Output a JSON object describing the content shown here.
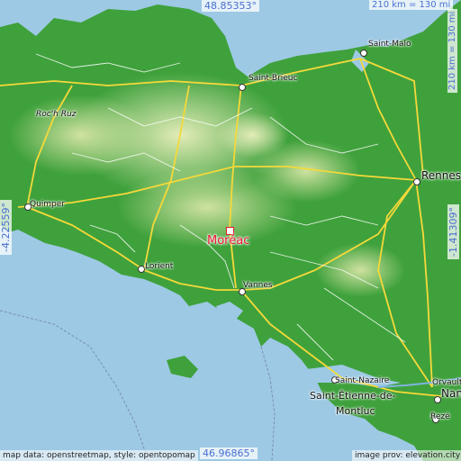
{
  "coords": {
    "top": "48.85353°",
    "bottom": "46.96865°",
    "left": "-4.22559°",
    "right": "-1.41309°",
    "scale_top": "210 km = 130 mi",
    "scale_right": "210 km = 130 mi"
  },
  "highlight_place": "Moréac",
  "places": {
    "saint_malo": "Saint-Malo",
    "saint_brieuc": "Saint-Brieuc",
    "roch_ruz": "Roc'h Ruz",
    "rennes": "Rennes",
    "quimper": "Quimper",
    "lorient": "Lorient",
    "vannes": "Vannes",
    "saint_nazaire": "Saint-Nazaire",
    "saint_etienne": "Saint-Étienne-de-",
    "montluc": "Montluc",
    "orvault": "Orvault",
    "nantes": "Nan",
    "reze": "Rezé"
  },
  "attribution": {
    "left": "map data: openstreetmap, style: opentopomap",
    "right": "image prov: elevation.city"
  },
  "colors": {
    "sea": "#9dc9e4",
    "lowland": "#3fa13c",
    "upland": "#c9e0a0",
    "road": "#f5d93a",
    "highlight": "#e8182c"
  }
}
